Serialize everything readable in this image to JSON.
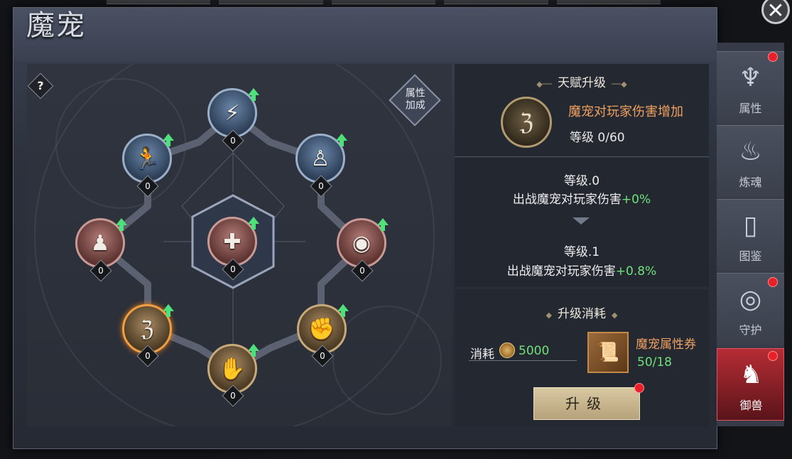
{
  "panel": {
    "title": "魔宠",
    "close_icon": "close-icon"
  },
  "tree": {
    "help_label": "?",
    "attr_bonus_label": "属性\n加成",
    "nodes": [
      {
        "id": "top",
        "level": "0",
        "icon": "shield-strike-icon",
        "color": "blue"
      },
      {
        "id": "upper-left",
        "level": "0",
        "icon": "running-figure-icon",
        "color": "blue"
      },
      {
        "id": "upper-right",
        "level": "0",
        "icon": "standing-figure-icon",
        "color": "blue"
      },
      {
        "id": "left",
        "level": "0",
        "icon": "body-power-icon",
        "color": "red"
      },
      {
        "id": "center",
        "level": "0",
        "icon": "heal-figure-icon",
        "color": "red"
      },
      {
        "id": "right",
        "level": "0",
        "icon": "eye-icon",
        "color": "red"
      },
      {
        "id": "lower-left",
        "level": "0",
        "icon": "talisman-icon",
        "color": "gold-active"
      },
      {
        "id": "lower-right",
        "level": "0",
        "icon": "fist-icon",
        "color": "gold"
      },
      {
        "id": "bottom",
        "level": "0",
        "icon": "punch-icon",
        "color": "gold"
      }
    ]
  },
  "talent": {
    "section_title": "天赋升级",
    "name": "魔宠对玩家伤害增加",
    "level": "等级 0/60"
  },
  "levels": {
    "current_level": "等级.0",
    "current_desc": "出战魔宠对玩家伤害",
    "current_value": "+0%",
    "next_level": "等级.1",
    "next_desc": "出战魔宠对玩家伤害",
    "next_value": "+0.8%"
  },
  "cost": {
    "section_title": "升级消耗",
    "label": "消耗",
    "amount": "5000",
    "item_name": "魔宠属性券",
    "item_count": "50/18",
    "upgrade_label": "升级"
  },
  "sidebar": {
    "tabs": [
      {
        "label": "属性",
        "icon": "demon-head-icon",
        "badge": true,
        "active": false
      },
      {
        "label": "炼魂",
        "icon": "soul-flame-icon",
        "badge": false,
        "active": false
      },
      {
        "label": "图鉴",
        "icon": "scroll-icon",
        "badge": false,
        "active": false
      },
      {
        "label": "守护",
        "icon": "swirl-icon",
        "badge": true,
        "active": false
      },
      {
        "label": "御兽",
        "icon": "beast-icon",
        "badge": true,
        "active": true
      }
    ]
  },
  "colors": {
    "accent_orange": "#f0a060",
    "value_green": "#6fe07b",
    "badge_red": "#e8202a",
    "active_tab": "#b62c34"
  }
}
